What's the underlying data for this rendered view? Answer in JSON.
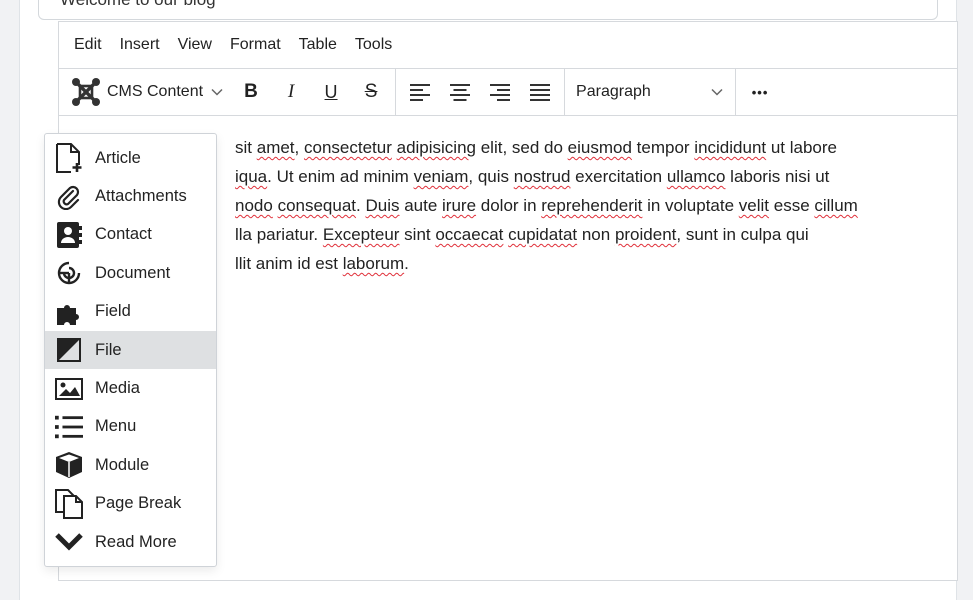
{
  "title_field": {
    "value": "Welcome to our blog"
  },
  "menubar": {
    "items": [
      "Edit",
      "Insert",
      "View",
      "Format",
      "Table",
      "Tools"
    ]
  },
  "toolbar": {
    "cms_label": "CMS Content",
    "bold": "B",
    "italic": "I",
    "underline": "U",
    "strike": "S",
    "paragraph": "Paragraph",
    "more": "•••"
  },
  "content": {
    "lines": [
      [
        "",
        " sit ",
        "amet",
        ", ",
        "consectetur",
        " ",
        "adipisicing",
        " elit, sed do ",
        "eiusmod",
        " tempor ",
        "incididunt",
        " ut labore"
      ],
      [
        "",
        "iqua",
        ". Ut enim ad minim ",
        "veniam",
        ", quis ",
        "nostrud",
        " exercitation ",
        "ullamco",
        " laboris nisi ut"
      ],
      [
        "",
        "nodo",
        " ",
        "consequat",
        ". ",
        "Duis",
        " aute ",
        "irure",
        " dolor in ",
        "reprehenderit",
        " in voluptate ",
        "velit",
        " esse ",
        "cillum"
      ],
      [
        "",
        "lla pariatur. ",
        "Excepteur",
        " sint ",
        "occaecat",
        " ",
        "cupidatat",
        " non ",
        "proident",
        ", sunt in culpa qui"
      ],
      [
        "",
        "llit anim id est ",
        "laborum",
        "."
      ]
    ]
  },
  "dropdown": {
    "items": [
      {
        "label": "Article",
        "icon": "article-add-icon"
      },
      {
        "label": "Attachments",
        "icon": "paperclip-icon"
      },
      {
        "label": "Contact",
        "icon": "contact-card-icon"
      },
      {
        "label": "Document",
        "icon": "document-logo-icon"
      },
      {
        "label": "Field",
        "icon": "puzzle-icon"
      },
      {
        "label": "File",
        "icon": "file-image-icon"
      },
      {
        "label": "Media",
        "icon": "image-icon"
      },
      {
        "label": "Menu",
        "icon": "list-icon"
      },
      {
        "label": "Module",
        "icon": "cube-icon"
      },
      {
        "label": "Page Break",
        "icon": "copy-pages-icon"
      },
      {
        "label": "Read More",
        "icon": "chevron-down-bold-icon"
      }
    ],
    "active": "File"
  }
}
